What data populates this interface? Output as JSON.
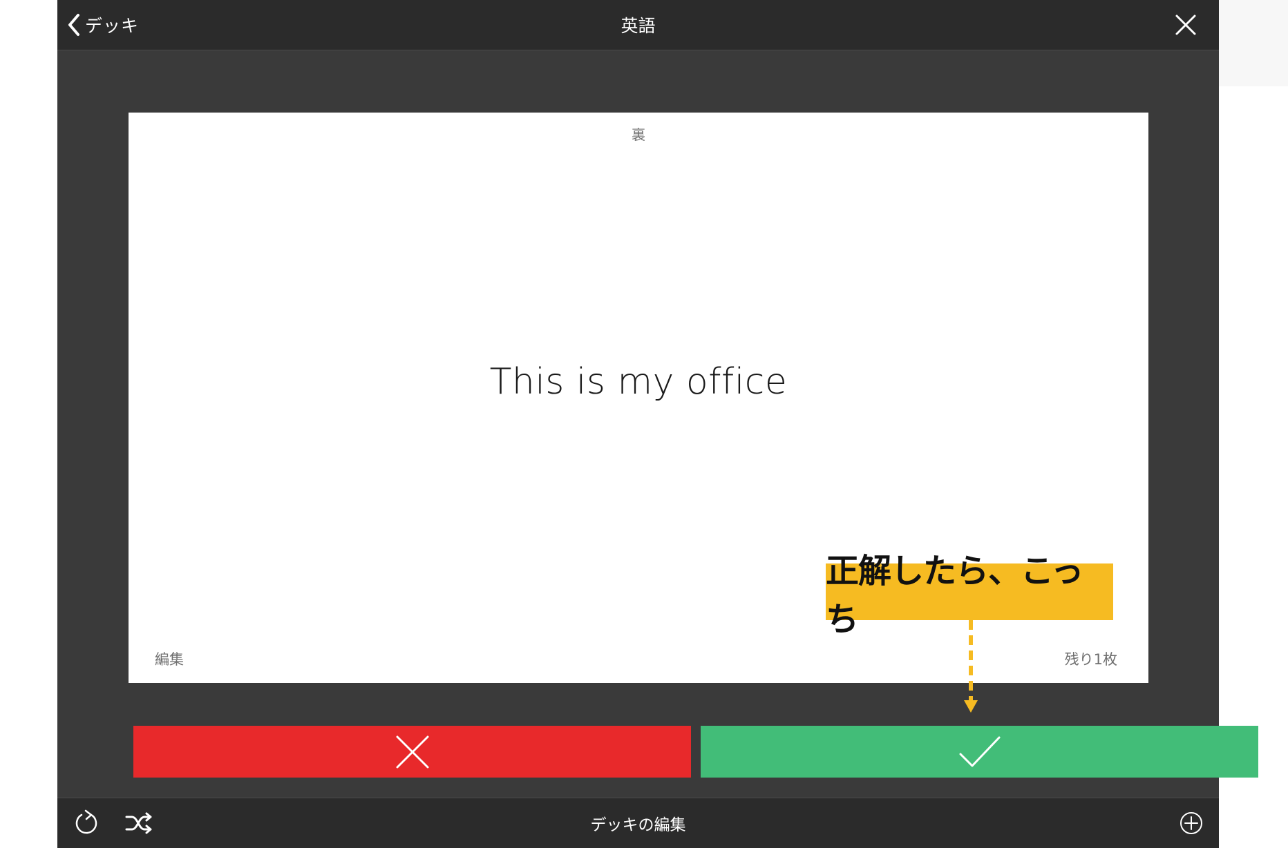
{
  "nav": {
    "back_label": "デッキ",
    "title": "英語"
  },
  "card": {
    "side_label": "裏",
    "text": "This is my office",
    "edit_label": "編集",
    "remaining_label": "残り1枚"
  },
  "annotation": {
    "text": "正解したら、こっち"
  },
  "buttons": {
    "wrong_icon": "x-icon",
    "correct_icon": "checkmark-icon"
  },
  "toolbar": {
    "edit_deck_label": "デッキの編集",
    "reset_icon": "refresh-icon",
    "shuffle_icon": "shuffle-icon",
    "add_icon": "plus-circle-icon"
  },
  "colors": {
    "wrong": "#e8292b",
    "correct": "#42bd78",
    "annotation": "#f6bb22",
    "background": "#3a3a3a"
  }
}
